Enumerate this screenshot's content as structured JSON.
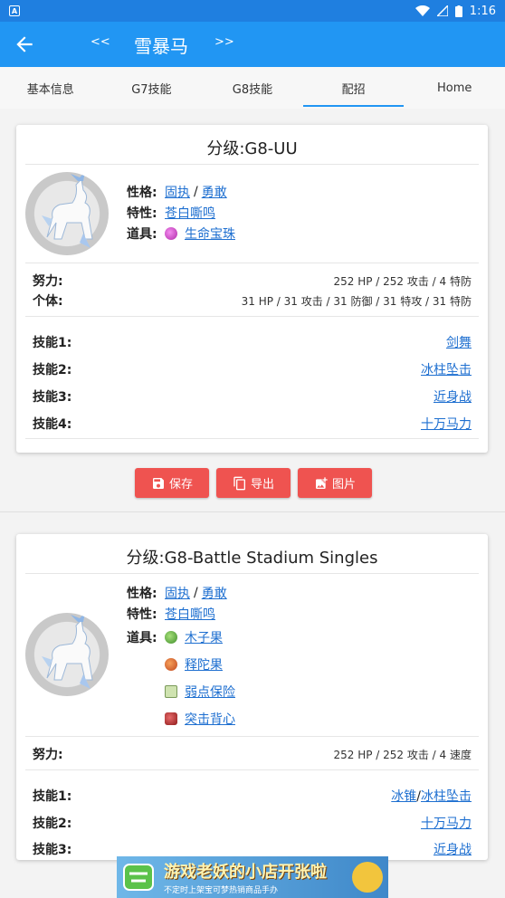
{
  "status": {
    "time": "1:16"
  },
  "appbar": {
    "prev": "<<",
    "title": "雪暴马",
    "next": ">>"
  },
  "tabs": [
    "基本信息",
    "G7技能",
    "G8技能",
    "配招",
    "Home"
  ],
  "card1": {
    "title": "分级:G8-UU",
    "nature_label": "性格:",
    "nature1": "固执",
    "slash": "/",
    "nature2": "勇敢",
    "ability_label": "特性:",
    "ability": "苍白嘶鸣",
    "item_label": "道具:",
    "item": "生命宝珠",
    "ev_label": "努力:",
    "ev": "252 HP / 252 攻击 / 4 特防",
    "iv_label": "个体:",
    "iv": "31 HP / 31 攻击 / 31 防御 / 31 特攻 / 31 特防",
    "moves": [
      {
        "label": "技能1:",
        "value": "剑舞"
      },
      {
        "label": "技能2:",
        "value": "冰柱坠击"
      },
      {
        "label": "技能3:",
        "value": "近身战"
      },
      {
        "label": "技能4:",
        "value": "十万马力"
      }
    ]
  },
  "buttons": {
    "save": "保存",
    "export": "导出",
    "image": "图片"
  },
  "card2": {
    "title": "分级:G8-Battle Stadium Singles",
    "nature_label": "性格:",
    "nature1": "固执",
    "slash": "/",
    "nature2": "勇敢",
    "ability_label": "特性:",
    "ability": "苍白嘶鸣",
    "item_label": "道具:",
    "items": [
      "木子果",
      "释陀果",
      "弱点保险",
      "突击背心"
    ],
    "ev_label": "努力:",
    "ev": "252 HP / 252 攻击 / 4 速度",
    "moves": [
      {
        "label": "技能1:",
        "value_a": "冰锥",
        "slash": "/",
        "value_b": "冰柱坠击"
      },
      {
        "label": "技能2:",
        "value": "十万马力"
      },
      {
        "label": "技能3:",
        "value": "近身战"
      }
    ]
  },
  "banner": {
    "title": "游戏老妖的小店开张啦",
    "subtitle": "不定时上架宝可梦热销商品手办"
  },
  "colors": {
    "appbar": "#2196f3",
    "statusbar": "#1f7fe0",
    "accent_button": "#ef5350",
    "link": "#1e6fd0"
  }
}
